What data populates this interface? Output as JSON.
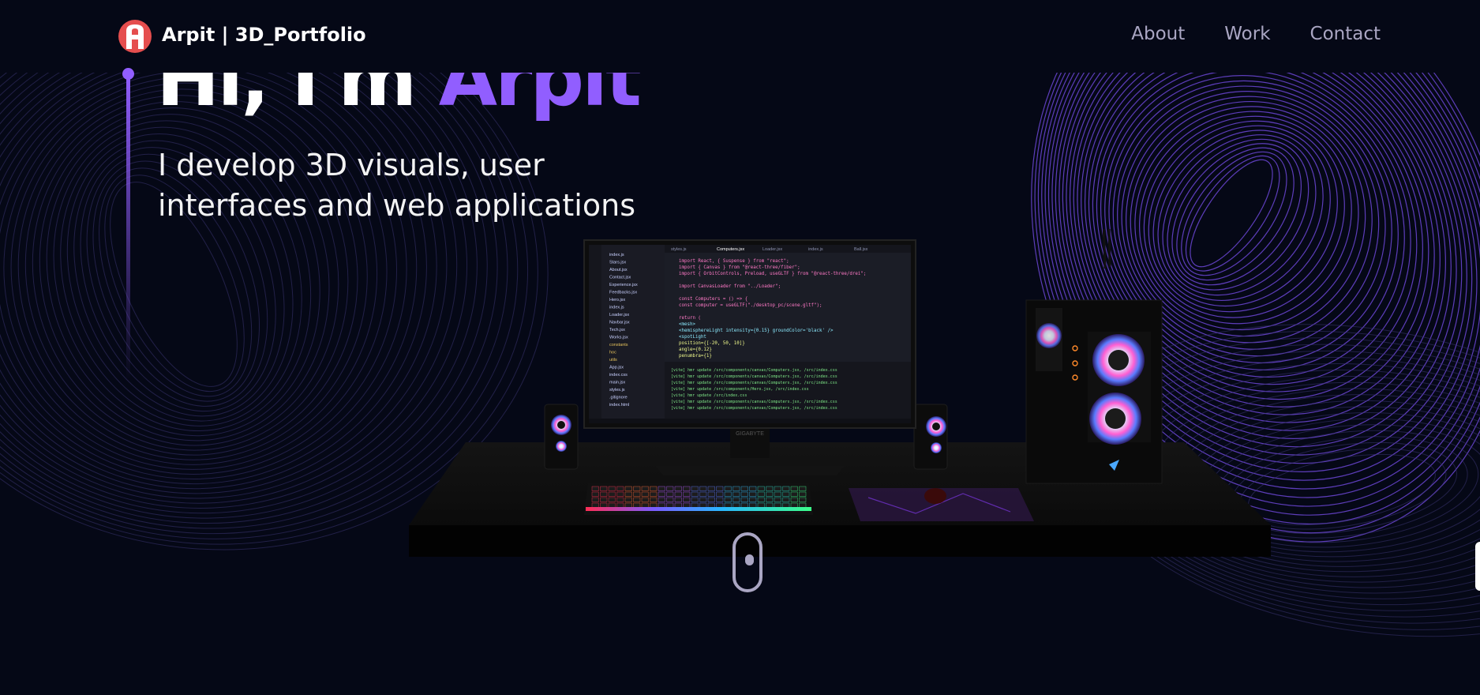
{
  "nav": {
    "brand": "Arpit | 3D_Portfolio",
    "logo_letter": "A",
    "links": [
      {
        "label": "About"
      },
      {
        "label": "Work"
      },
      {
        "label": "Contact"
      }
    ]
  },
  "hero": {
    "greeting": "Hi, I'm ",
    "name": "Arpit",
    "subtitle_line1": "I develop 3D visuals, user",
    "subtitle_line2": "interfaces and web applications"
  },
  "scene": {
    "monitor_brand": "GIGABYTE",
    "code_lines": [
      "import React, { Suspense } from \"react\";",
      "import { Canvas } from \"@react-three/fiber\";",
      "import { OrbitControls, Preload, useGLTF } from \"@react-three/drei\";",
      "",
      "import CanvasLoader from \"../Loader\";",
      "",
      "const Computers = () => {",
      "  const computer = useGLTF(\"./desktop_pc/scene.gltf\");",
      "",
      "  return (",
      "    <mesh>",
      "      <hemisphereLight intensity={0.15} groundColor='black' />",
      "      <spotLight",
      "        position={[-20, 50, 10]}",
      "        angle={0.12}",
      "        penumbra={1}"
    ],
    "files": [
      "index.js",
      "Stars.jsx",
      "About.jsx",
      "Contact.jsx",
      "Experience.jsx",
      "Feedbacks.jsx",
      "Hero.jsx",
      "index.js",
      "Loader.jsx",
      "Navbar.jsx",
      "Tech.jsx",
      "Works.jsx",
      "constants",
      "hoc",
      "utils",
      "App.jsx",
      "index.css",
      "main.jsx",
      "styles.js",
      ".gitignore",
      "index.html"
    ],
    "tabs": [
      "styles.js",
      "Computers.jsx",
      "Loader.jsx",
      "index.js",
      "Ball.jsx"
    ],
    "terminal_lines": [
      "[vite] hmr update /src/components/canvas/Computers.jsx, /src/index.css",
      "[vite] hmr update /src/components/canvas/Computers.jsx, /src/index.css",
      "[vite] hmr update /src/components/canvas/Computers.jsx, /src/index.css",
      "[vite] hmr update /src/components/Hero.jsx, /src/index.css",
      "[vite] hmr update /src/index.css",
      "[vite] hmr update /src/components/canvas/Computers.jsx, /src/index.css",
      "[vite] hmr update /src/components/canvas/Computers.jsx, /src/index.css"
    ]
  },
  "colors": {
    "background": "#050816",
    "accent": "#915eff",
    "nav_link": "#aaa6c3",
    "logo": "#e54e4e"
  },
  "icons": {
    "logo": "logo-icon",
    "scroll": "mouse-scroll-icon"
  }
}
